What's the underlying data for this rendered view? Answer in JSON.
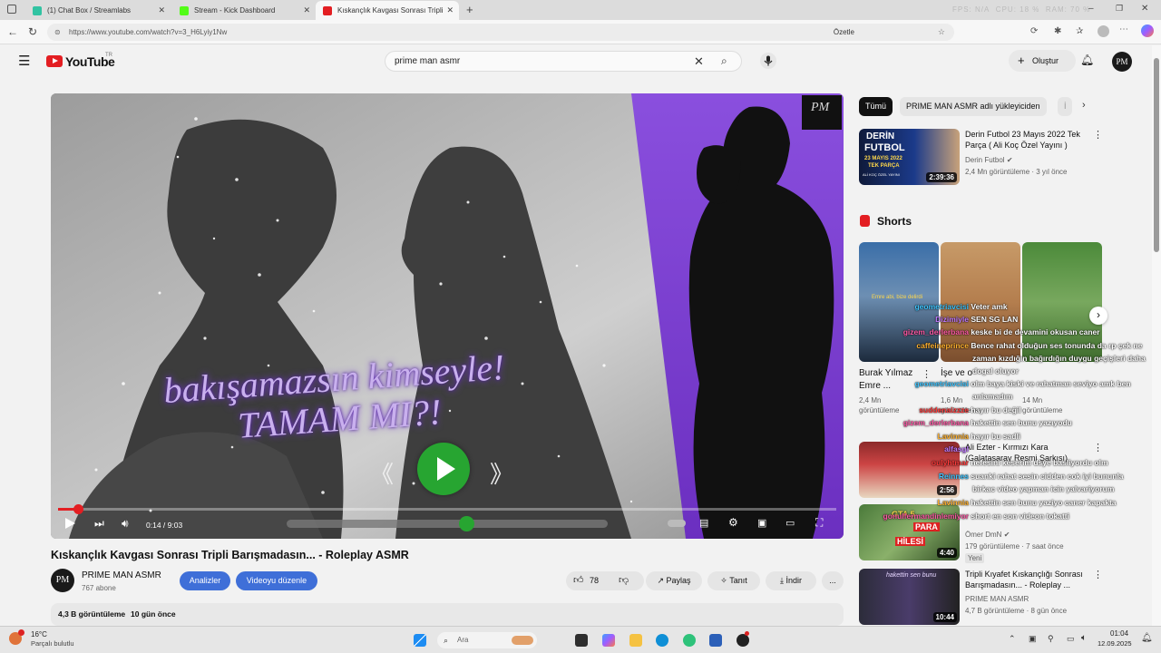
{
  "browser": {
    "tabs": [
      {
        "title": "(1) Chat Box / Streamlabs",
        "active": false,
        "color": "#31c3a2"
      },
      {
        "title": "Stream - Kick Dashboard",
        "active": false,
        "color": "#53fc18"
      },
      {
        "title": "Kıskançlık Kavgası Sonrası Tripli B",
        "active": true,
        "color": "#e31e22"
      }
    ],
    "url": "https://www.youtube.com/watch?v=3_H6Lyiy1Nw",
    "right_labels": [
      "Özetle"
    ],
    "faded_status": [
      "FPS: N/A",
      "CPU: 18 %",
      "RAM: 70 %"
    ]
  },
  "youtube": {
    "logo_text": "YouTube",
    "logo_country": "TR",
    "search_value": "prime man asmr",
    "create_label": "Oluştur",
    "avatar_initials": "PM",
    "video": {
      "caption_line1": "bakışamazsın kimseyle!",
      "caption_line2": "TAMAM MI?!",
      "time": "0:14 / 9:03",
      "progress_fraction": 0.026,
      "volume_fraction": 0.56,
      "watermark": "PM"
    },
    "title": "Kıskançlık Kavgası Sonrası Tripli Barışmadasın... - Roleplay ASMR",
    "channel": {
      "name": "PRIME MAN ASMR",
      "subs": "767 abone",
      "initials": "PM"
    },
    "actions": {
      "analytics": "Analizler",
      "edit": "Videoyu düzenle",
      "likes": "78",
      "share": "Paylaş",
      "thanks": "Tanıt",
      "download": "İndir",
      "more": "..."
    },
    "desc": {
      "views": "4,3 B görüntüleme",
      "date": "10 gün önce"
    },
    "chips": [
      "Tümü",
      "PRIME MAN ASMR adlı yükleyiciden",
      "İ"
    ],
    "rec1": {
      "title": "Derin Futbol 23 Mayıs 2022 Tek Parça ( Ali Koç Özel Yayını )",
      "title_line1": "Derin Futbol 23 Mayıs 2022 Tek",
      "title_line2": "Parça ( Ali Koç Özel Yayını )",
      "channel": "Derin Futbol",
      "meta": "2,4 Mn görüntüleme · 3 yıl önce",
      "duration": "2:39:36",
      "thumb_text1": "DERİN",
      "thumb_text2": "FUTBOL",
      "thumb_text3": "23 MAYIS 2022",
      "thumb_text4": "TEK PARÇA",
      "thumb_text5": "ALİ KOÇ ÖZEL YAYINI"
    },
    "shorts_label": "Shorts",
    "shorts": [
      {
        "title_line1": "Burak Yılmaz",
        "title_line2": "Emre ...",
        "views1": "2,4 Mn",
        "views2": "görüntüleme",
        "thumb_caption": "Emre abi, bize delirdi"
      },
      {
        "title_line1": "İşe ve o",
        "title_line2": "",
        "views1": "1,6 Mn",
        "views2": "görüntüleme"
      },
      {
        "title_line1": "",
        "title_line2": "",
        "views1": "14 Mn",
        "views2": "görüntüleme"
      }
    ],
    "rec2": {
      "title_line1": "Ali Ezter - Kırmızı Kara",
      "title_line2": "(Galatasaray Resmi Şarkısı)",
      "duration": "2:56"
    },
    "rec3": {
      "channel": "Ömer DmN",
      "meta": "179 görüntüleme · 7 saat önce",
      "badge": "Yeni",
      "duration": "4:40",
      "thumb_text1": "GTA 5",
      "thumb_text2": "PARA",
      "thumb_text3": "HİLESİ"
    },
    "rec4": {
      "title_line1": "Tripli Kıyafet Kıskançlığı Sonrası",
      "title_line2": "Barışmadasın... - Roleplay ...",
      "channel": "PRIME MAN ASMR",
      "meta": "4,7 B görüntüleme · 8 gün önce",
      "duration": "10:44",
      "thumb_text": "hakettin sen bunu"
    }
  },
  "chat_overlay": [
    {
      "user": "geometriavcisi",
      "msg": "Veter amk",
      "ucolor": "#3fc5ff"
    },
    {
      "user": "Dizimiyle",
      "msg": "SEN SG LAN",
      "ucolor": "#c07bff"
    },
    {
      "user": "gizem_derlerbana",
      "msg": "keske bi de devamini okusan caner",
      "ucolor": "#ff5aa6"
    },
    {
      "user": "caffeineprince",
      "msg": "Bence rahat olduğun ses tonunda da rp çek ne",
      "ucolor": "#ffb12f"
    },
    {
      "user": "",
      "msg": "zaman kızdığın bağırdığın duygu geçişleri daha",
      "ucolor": "#ffffff"
    },
    {
      "user": "",
      "msg": "dogal oluyor",
      "ucolor": "#ffffff"
    },
    {
      "user": "geometriavcisi",
      "msg": "olm baya kiski ve rahatman seviyo amk ben",
      "ucolor": "#3fc5ff"
    },
    {
      "user": "",
      "msg": "anlamadım",
      "ucolor": "#ffffff"
    },
    {
      "user": "suddenaizzze",
      "msg": "hayır bu değil",
      "ucolor": "#ff3b3b"
    },
    {
      "user": "gizem_derlerbana",
      "msg": "hakettin sen bunu yazıyodu",
      "ucolor": "#ff5aa6"
    },
    {
      "user": "Lavinnia",
      "msg": "hayır bu sadli",
      "ucolor": "#ffb12f"
    },
    {
      "user": "alfasgl",
      "msg": "",
      "ucolor": "#c07bff"
    },
    {
      "user": "oulyhtmar",
      "msg": "nefesini keserim dsye basliyordu olm",
      "ucolor": "#ff3b3b"
    },
    {
      "user": "Reinnes",
      "msg": "suanki rahat sesin cidden cok iyi bununla",
      "ucolor": "#3fc5ff"
    },
    {
      "user": "",
      "msg": "birkac video yapman icin yalvariyorum",
      "ucolor": "#ffffff"
    },
    {
      "user": "Lavinnia",
      "msg": "hakettin sen bunu yaziyo caner kapakta",
      "ucolor": "#ffb12f"
    },
    {
      "user": "gonulfermandinlemiyor",
      "msg": "short en son videon tokatti",
      "ucolor": "#ff5aa6"
    }
  ],
  "taskbar": {
    "weather_temp": "16°C",
    "weather_desc": "Parçalı bulutlu",
    "search_label": "Ara",
    "time": "01:04",
    "date": "12.09.2025"
  },
  "colors": {
    "yt_red": "#e31e22",
    "purple": "#8a3fd6",
    "pill_blue": "#3f6fd8",
    "play_green": "#27a531"
  }
}
